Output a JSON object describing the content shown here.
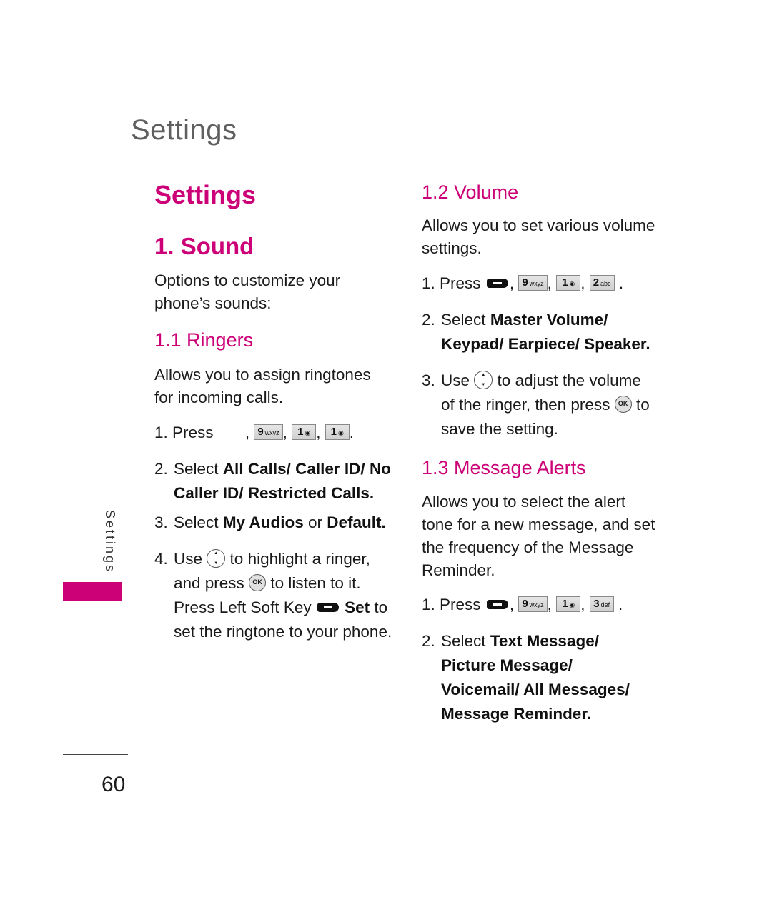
{
  "running_head": "Settings",
  "section_title": "Settings",
  "accent_color": "#cc0077",
  "sound": {
    "heading": "1. Sound",
    "intro": [
      "Options to customize your",
      "phone’s sounds:"
    ]
  },
  "ringers": {
    "heading": "1.1 Ringers",
    "desc": [
      "Allows you to assign ringtones",
      "for incoming calls."
    ],
    "step1": {
      "num": "1.",
      "label": "Press",
      "keys": [
        "9",
        "1",
        "1"
      ],
      "key_subs": [
        "wxyz",
        "voicemail",
        "voicemail"
      ]
    },
    "step2": {
      "num": "2.",
      "pre": "Select",
      "options": [
        "All Calls/",
        "Caller ID/",
        "No Caller ID/",
        "Restricted Calls."
      ]
    },
    "step3": {
      "num": "3.",
      "pre": "Select",
      "opt1": "My Audios",
      "mid": "or",
      "opt2": "Default."
    },
    "step4": {
      "num": "4.",
      "use": "Use",
      "after_nav": "to highlight a ringer,",
      "and_press": "and press",
      "after_ok": "to listen to it.",
      "press_lsk": "Press Left Soft Key",
      "set": "Set",
      "to": "to",
      "end": "set the ringtone to your phone."
    }
  },
  "volume": {
    "heading": "1.2 Volume",
    "desc": [
      "Allows you to set various volume",
      "settings."
    ],
    "step1": {
      "num": "1.",
      "label": "Press",
      "keys": [
        "9",
        "1",
        "2"
      ],
      "key_subs": [
        "wxyz",
        "voicemail",
        "abc"
      ]
    },
    "step2": {
      "num": "2.",
      "pre": "Select",
      "options": "Master Volume/ Keypad/ Earpiece/ Speaker."
    },
    "step3": {
      "num": "3.",
      "use": "Use",
      "after_nav": "to adjust the volume",
      "line2": "of the ringer, then press",
      "to": "to",
      "line3": "save the setting."
    }
  },
  "message_alerts": {
    "heading": "1.3 Message Alerts",
    "desc": [
      "Allows you to select the alert",
      "tone for a new message, and set",
      "the frequency of the Message",
      "Reminder."
    ],
    "step1": {
      "num": "1.",
      "label": "Press",
      "keys": [
        "9",
        "1",
        "3"
      ],
      "key_subs": [
        "wxyz",
        "voicemail",
        "def"
      ]
    },
    "step2": {
      "num": "2.",
      "pre": "Select",
      "options": "Text Message/ Picture Message/ Voicemail/ All Messages/ Message Reminder."
    }
  },
  "side_tab": "Settings",
  "page_number": "60"
}
